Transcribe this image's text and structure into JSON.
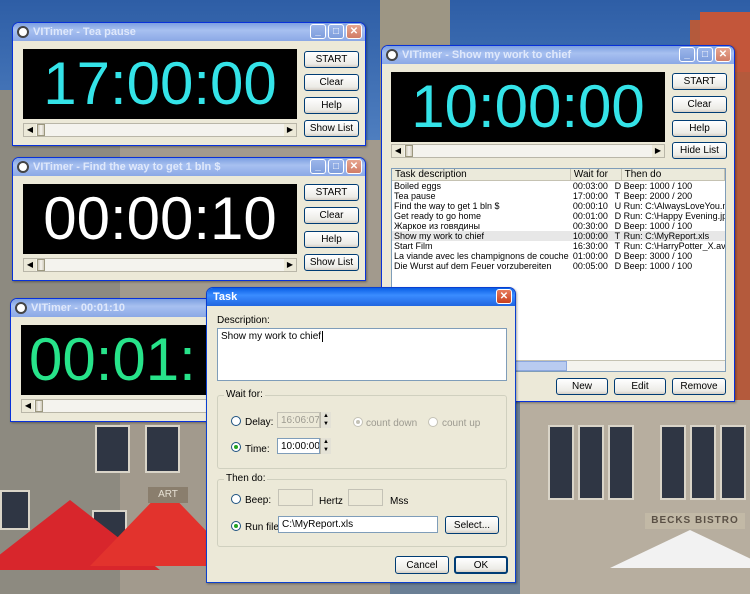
{
  "windows": {
    "tea": {
      "title": "VITimer - Tea pause",
      "time": "17:00:00",
      "time_color": "#34e3e8",
      "buttons": {
        "start": "START",
        "clear": "Clear",
        "help": "Help",
        "list": "Show List"
      }
    },
    "findway": {
      "title": "VITimer - Find the way to get 1 bln $",
      "time": "00:00:10",
      "time_color": "#ffffff",
      "buttons": {
        "start": "START",
        "clear": "Clear",
        "help": "Help",
        "list": "Show List"
      }
    },
    "countdown": {
      "title": "VITimer - 00:01:10",
      "time": "00:01:",
      "time_color": "#27e38a"
    },
    "chief": {
      "title": "VITimer - Show my work to chief",
      "time": "10:00:00",
      "time_color": "#34e3e8",
      "buttons": {
        "start": "START",
        "clear": "Clear",
        "help": "Help",
        "list": "Hide List",
        "new": "New",
        "edit": "Edit",
        "remove": "Remove"
      }
    }
  },
  "task_list": {
    "columns": [
      "Task description",
      "Wait for",
      "Then do"
    ],
    "rows": [
      {
        "desc": "Boiled eggs",
        "wait": "00:03:00",
        "mode": "D",
        "action": "Beep: 1000 / 100"
      },
      {
        "desc": "Tea pause",
        "wait": "17:00:00",
        "mode": "T",
        "action": "Beep: 2000 / 200"
      },
      {
        "desc": "Find the way to get 1 bln $",
        "wait": "00:00:10",
        "mode": "U",
        "action": "Run: C:\\AlwaysLoveYou.mp"
      },
      {
        "desc": "Get ready to go home",
        "wait": "00:01:00",
        "mode": "D",
        "action": "Run: C:\\Happy Evening.jpg"
      },
      {
        "desc": "Жаркое из говядины",
        "wait": "00:30:00",
        "mode": "D",
        "action": "Beep: 1000 / 100"
      },
      {
        "desc": "Show my work to chief",
        "wait": "10:00:00",
        "mode": "T",
        "action": "Run: C:\\MyReport.xls",
        "selected": true
      },
      {
        "desc": "Start Film",
        "wait": "16:30:00",
        "mode": "T",
        "action": "Run: C:\\HarryPotter_X.avi"
      },
      {
        "desc": "La viande avec les champignons de couche",
        "wait": "01:00:00",
        "mode": "D",
        "action": "Beep: 3000 / 100"
      },
      {
        "desc": "Die Wurst auf dem Feuer vorzubereiten",
        "wait": "00:05:00",
        "mode": "D",
        "action": "Beep: 1000 / 100"
      }
    ]
  },
  "task_dialog": {
    "title": "Task",
    "description_label": "Description:",
    "description_value": "Show my work to chief",
    "wait_group": "Wait for:",
    "delay_label": "Delay:",
    "delay_value": "16:06:07",
    "count_down": "count down",
    "count_up": "count up",
    "time_label": "Time:",
    "time_value": "10:00:00",
    "then_group": "Then do:",
    "beep_label": "Beep:",
    "hertz": "Hertz",
    "mss": "Mss",
    "run_label": "Run file:",
    "run_value": "C:\\MyReport.xls",
    "select_button": "Select...",
    "cancel_button": "Cancel",
    "ok_button": "OK"
  },
  "scenery": {
    "bistro_sign": "BECKS BISTRO",
    "art_sign": "ART"
  }
}
